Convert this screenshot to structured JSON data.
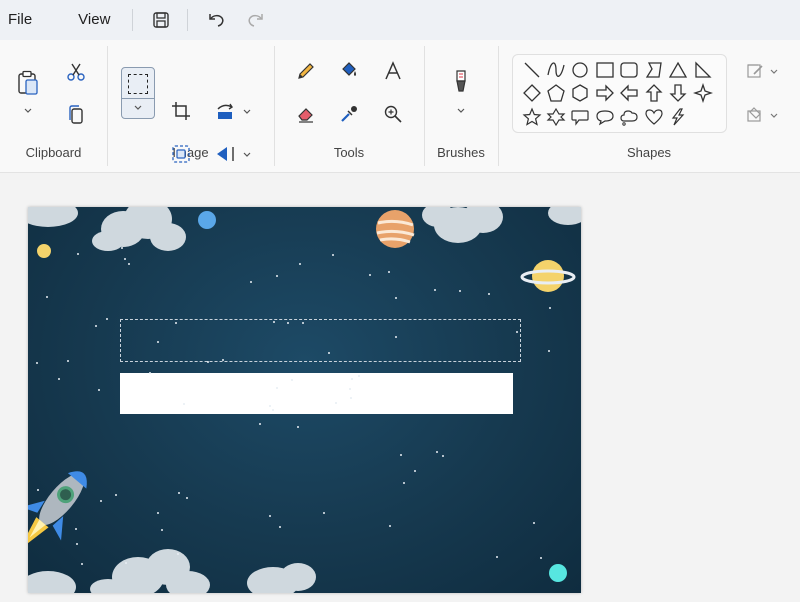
{
  "menu": {
    "file": "File",
    "view": "View"
  },
  "groups": {
    "clipboard": "Clipboard",
    "image": "Image",
    "tools": "Tools",
    "brushes": "Brushes",
    "shapes": "Shapes"
  },
  "icons": {
    "save": "save-icon",
    "undo": "undo-icon",
    "redo": "redo-icon",
    "paste": "paste-icon",
    "cut": "cut-icon",
    "copy": "copy-icon",
    "select": "select-icon",
    "crop": "crop-icon",
    "resize": "resize-icon",
    "rotate": "rotate-icon",
    "image_ai": "image-ai-icon",
    "flip": "flip-icon",
    "pencil": "pencil-icon",
    "fill": "fill-icon",
    "text": "text-icon",
    "eraser": "eraser-icon",
    "color_picker": "color-picker-icon",
    "magnifier": "magnifier-icon",
    "brush": "brush-icon",
    "outline": "outline-icon",
    "shape_fill": "shape-fill-icon"
  },
  "colors": {
    "accent": "#1f5fbf",
    "canvas_bg": "#16394f",
    "eraser": "#e55d6b"
  }
}
